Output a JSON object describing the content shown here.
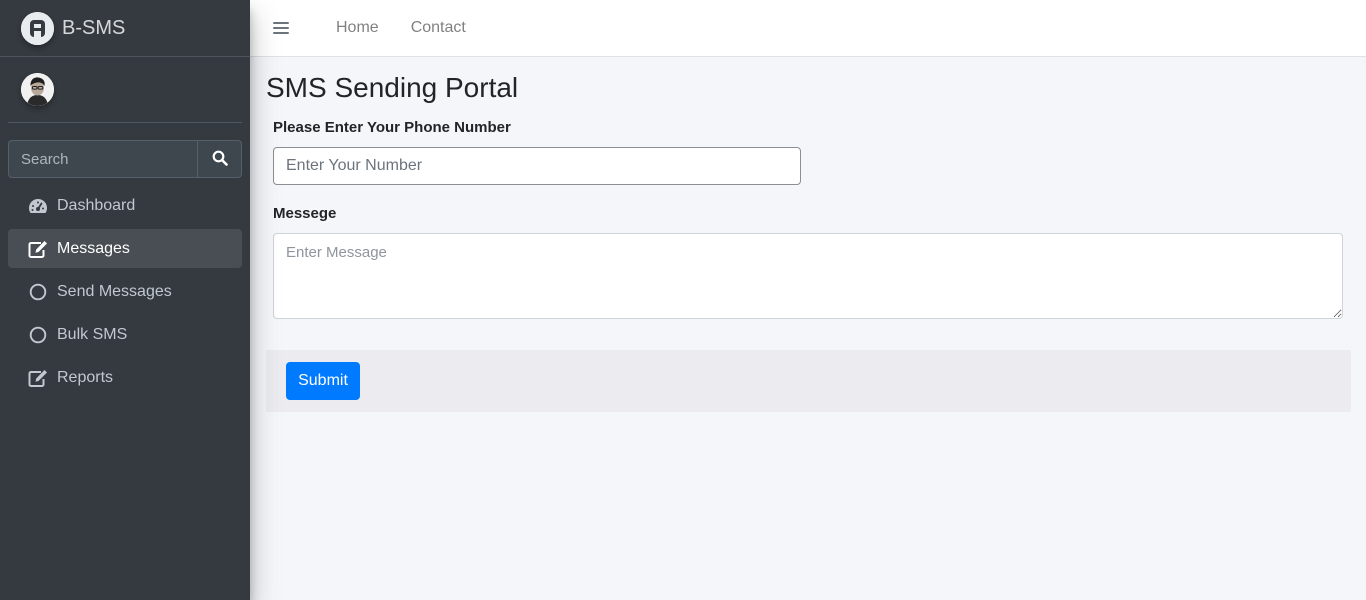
{
  "brand": {
    "name": "B-SMS",
    "logo_icon": "brand-logo-icon"
  },
  "search": {
    "placeholder": "Search",
    "icon": "search-icon"
  },
  "sidebar": {
    "items": [
      {
        "label": "Dashboard",
        "icon": "tachometer-icon",
        "active": false
      },
      {
        "label": "Messages",
        "icon": "edit-icon",
        "active": true
      },
      {
        "label": "Send Messages",
        "icon": "circle-icon",
        "active": false
      },
      {
        "label": "Bulk SMS",
        "icon": "circle-icon",
        "active": false
      },
      {
        "label": "Reports",
        "icon": "edit-icon",
        "active": false
      }
    ]
  },
  "topbar": {
    "menu_icon": "hamburger-icon",
    "links": [
      "Home",
      "Contact"
    ]
  },
  "main": {
    "title": "SMS Sending Portal",
    "phone_label": "Please Enter Your Phone Number",
    "phone_placeholder": "Enter Your Number",
    "message_label": "Messege",
    "message_placeholder": "Enter Message",
    "submit_label": "Submit"
  },
  "colors": {
    "sidebar_bg": "#343a40",
    "content_bg": "#f4f6f9",
    "primary": "#007bff"
  }
}
